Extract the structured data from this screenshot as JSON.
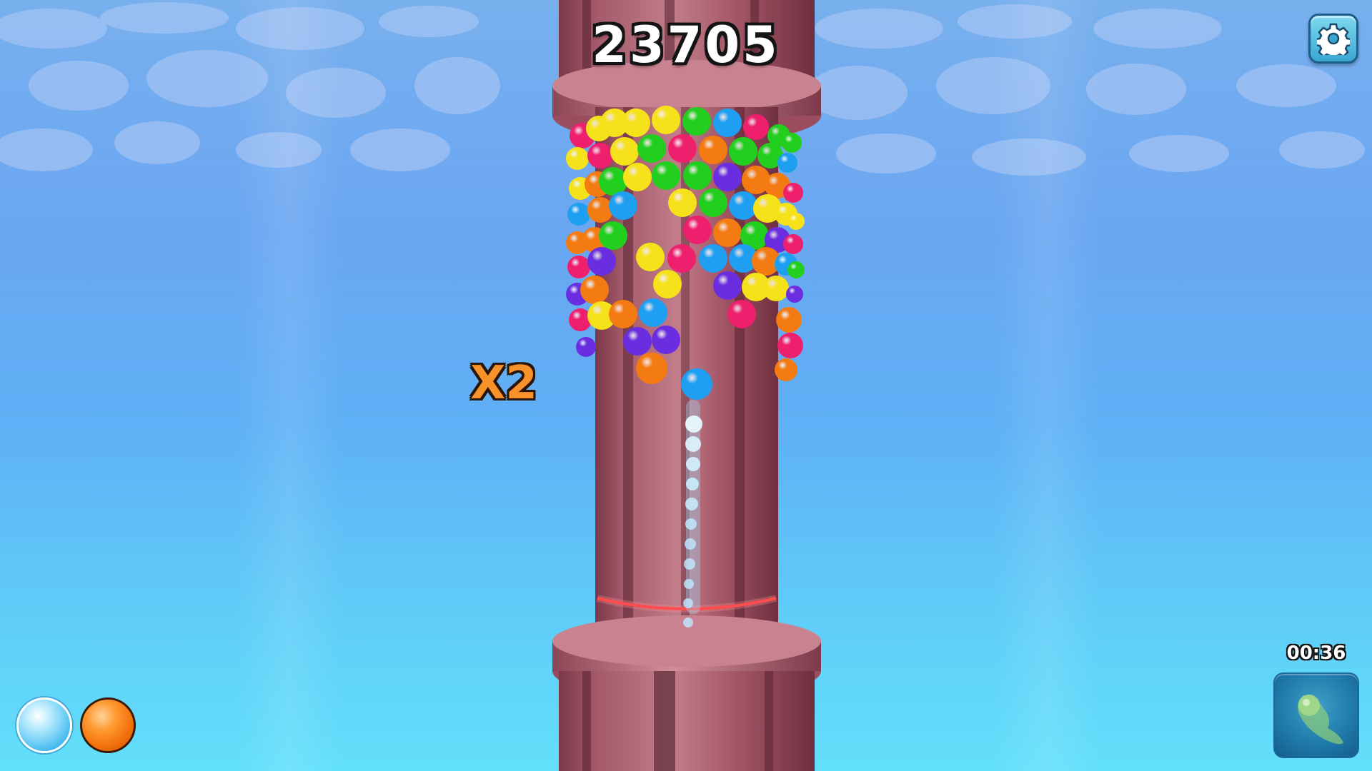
{
  "hud": {
    "score": "23705",
    "multiplier": "X2",
    "timer": "00:36",
    "settings_icon": "gear-icon",
    "powerup_icon": "comet-powerup-icon"
  },
  "next_balls": [
    {
      "color": "light-blue",
      "hex": "#5cc6f3"
    },
    {
      "color": "orange",
      "hex": "#f47b12"
    }
  ],
  "palette": {
    "ball_colors": [
      "#f6e21a",
      "#22cf1e",
      "#ee1f6d",
      "#f47b12",
      "#1e9ff2",
      "#6a2ee0"
    ],
    "tower": "#b06a78",
    "laser": "#ff3030",
    "sky_top": "#78b0ee",
    "sky_bottom": "#62e0fb"
  }
}
